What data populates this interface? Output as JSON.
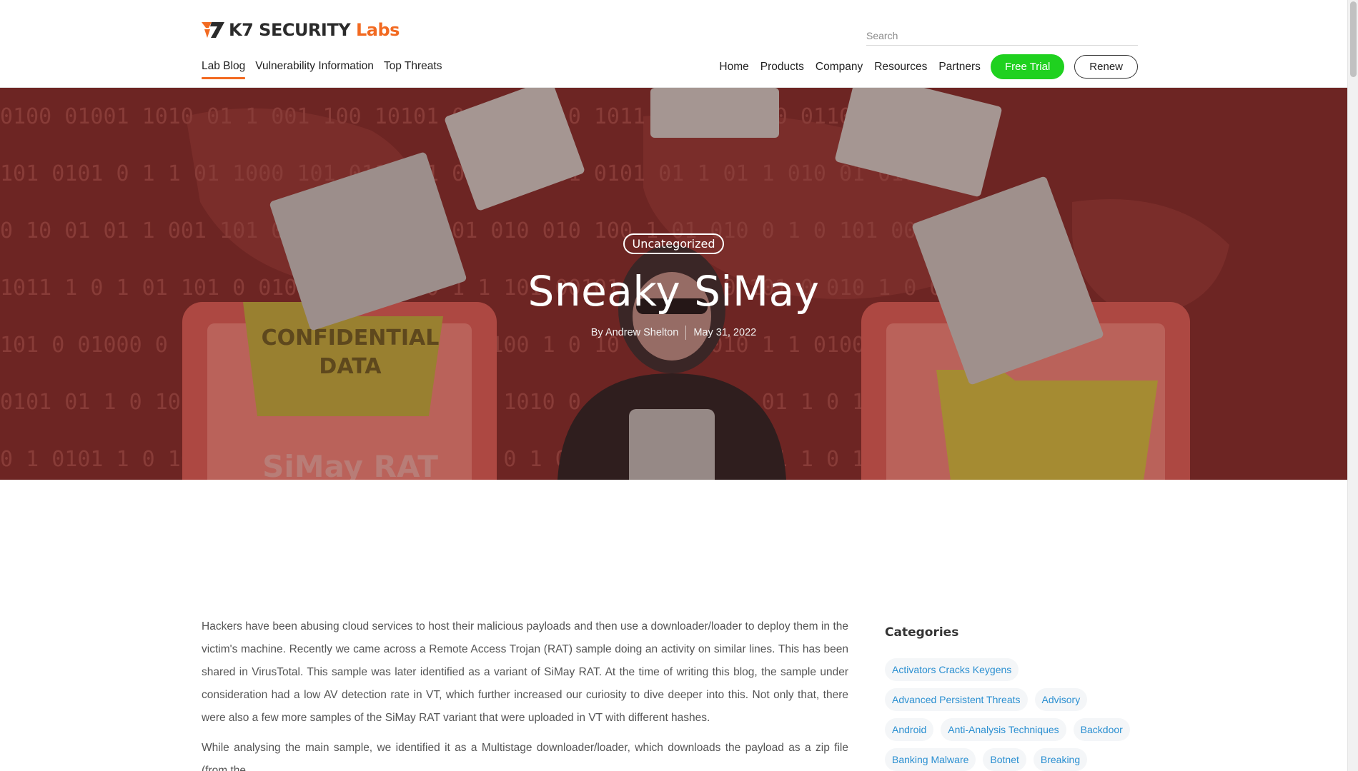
{
  "brand": {
    "logo_name": "K7 SECURITY",
    "logo_suffix": "Labs",
    "accent_color": "#f26a21"
  },
  "search": {
    "placeholder": "Search"
  },
  "left_nav": [
    {
      "label": "Lab Blog",
      "active": true
    },
    {
      "label": "Vulnerability Information",
      "active": false
    },
    {
      "label": "Top Threats",
      "active": false
    }
  ],
  "right_nav": [
    {
      "label": "Home"
    },
    {
      "label": "Products"
    },
    {
      "label": "Company"
    },
    {
      "label": "Resources"
    },
    {
      "label": "Partners"
    }
  ],
  "buttons": {
    "free_trial": "Free Trial",
    "free_trial_color": "#1fd11f",
    "renew": "Renew"
  },
  "hero": {
    "category": "Uncategorized",
    "title": "Sneaky SiMay",
    "author": "By Andrew Shelton",
    "date": "May 31, 2022",
    "image_text_left": "CONFIDENTIAL DATA",
    "image_text_bottom": "SiMay RAT"
  },
  "article": {
    "paragraphs": [
      "Hackers have been abusing cloud services to host their malicious payloads and then use a downloader/loader to deploy them in the victim's machine. Recently we came across a Remote Access Trojan (RAT) sample doing an activity on similar lines. This has been shared in VirusTotal. This sample was later identified as a variant of SiMay RAT. At the time of writing this blog, the sample under consideration had a low AV detection rate in VT, which further increased our curiosity to dive deeper into this. Not only that, there were also a few more samples of the SiMay RAT variant that were uploaded in VT with different hashes.",
      "While analysing the main sample, we identified it as a Multistage downloader/loader, which downloads the payload as a zip file (from the"
    ]
  },
  "sidebar": {
    "title": "Categories",
    "tags": [
      "Activators Cracks Keygens",
      "Advanced Persistent Threats",
      "Advisory",
      "Android",
      "Anti-Analysis Techniques",
      "Backdoor",
      "Banking Malware",
      "Botnet",
      "Breaking"
    ]
  }
}
